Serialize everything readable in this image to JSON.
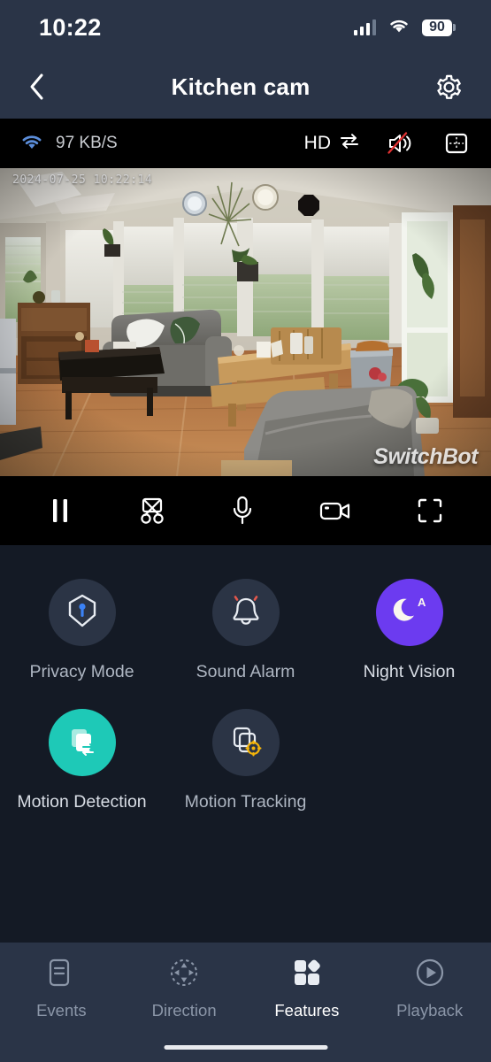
{
  "status_bar": {
    "time": "10:22",
    "battery_level": "90",
    "cellular_icon": "cellular-bars-icon",
    "wifi_icon": "wifi-icon",
    "battery_icon": "battery-icon"
  },
  "header": {
    "title": "Kitchen cam",
    "back_icon": "chevron-left-icon",
    "settings_icon": "gear-icon"
  },
  "video_strip": {
    "network_speed": "97 KB/S",
    "wifi_icon": "wifi-signal-icon",
    "quality_label": "HD",
    "quality_swap_icon": "swap-arrows-icon",
    "speaker_icon": "speaker-muted-icon",
    "grid_icon": "split-view-icon"
  },
  "video": {
    "timestamp": "2024-07-25 10:22:14",
    "watermark": "SwitchBot",
    "scene_description": "Living room with grey sofa, wood coffee table, dining table and windows"
  },
  "controls": [
    {
      "name": "pause-button",
      "icon": "pause-icon"
    },
    {
      "name": "snapshot-button",
      "icon": "scissors-icon"
    },
    {
      "name": "talk-button",
      "icon": "microphone-icon"
    },
    {
      "name": "record-button",
      "icon": "video-camera-icon"
    },
    {
      "name": "fullscreen-button",
      "icon": "fullscreen-icon"
    }
  ],
  "features": {
    "row1": [
      {
        "label": "Privacy Mode",
        "icon": "shield-key-icon",
        "active": false,
        "state_color": "#2b3445"
      },
      {
        "label": "Sound Alarm",
        "icon": "alarm-bell-icon",
        "active": false,
        "state_color": "#2b3445"
      },
      {
        "label": "Night Vision",
        "icon": "moon-auto-icon",
        "active": true,
        "state_color": "#6c3bf0"
      }
    ],
    "row2": [
      {
        "label": "Motion Detection",
        "icon": "motion-detection-icon",
        "active": true,
        "state_color": "#1ec9b7"
      },
      {
        "label": "Motion Tracking",
        "icon": "motion-tracking-icon",
        "active": false,
        "state_color": "#2b3445"
      }
    ]
  },
  "bottom_nav": [
    {
      "label": "Events",
      "icon": "document-icon",
      "active": false
    },
    {
      "label": "Direction",
      "icon": "dpad-icon",
      "active": false
    },
    {
      "label": "Features",
      "icon": "grid-squares-icon",
      "active": true
    },
    {
      "label": "Playback",
      "icon": "play-circle-icon",
      "active": false
    }
  ],
  "colors": {
    "bar_bg": "#2a3447",
    "page_bg": "#141a25",
    "accent_purple": "#6c3bf0",
    "accent_teal": "#1ec9b7",
    "accent_blue": "#3b82f6",
    "accent_yellow": "#f5b50a",
    "mute_red": "#e03131"
  }
}
